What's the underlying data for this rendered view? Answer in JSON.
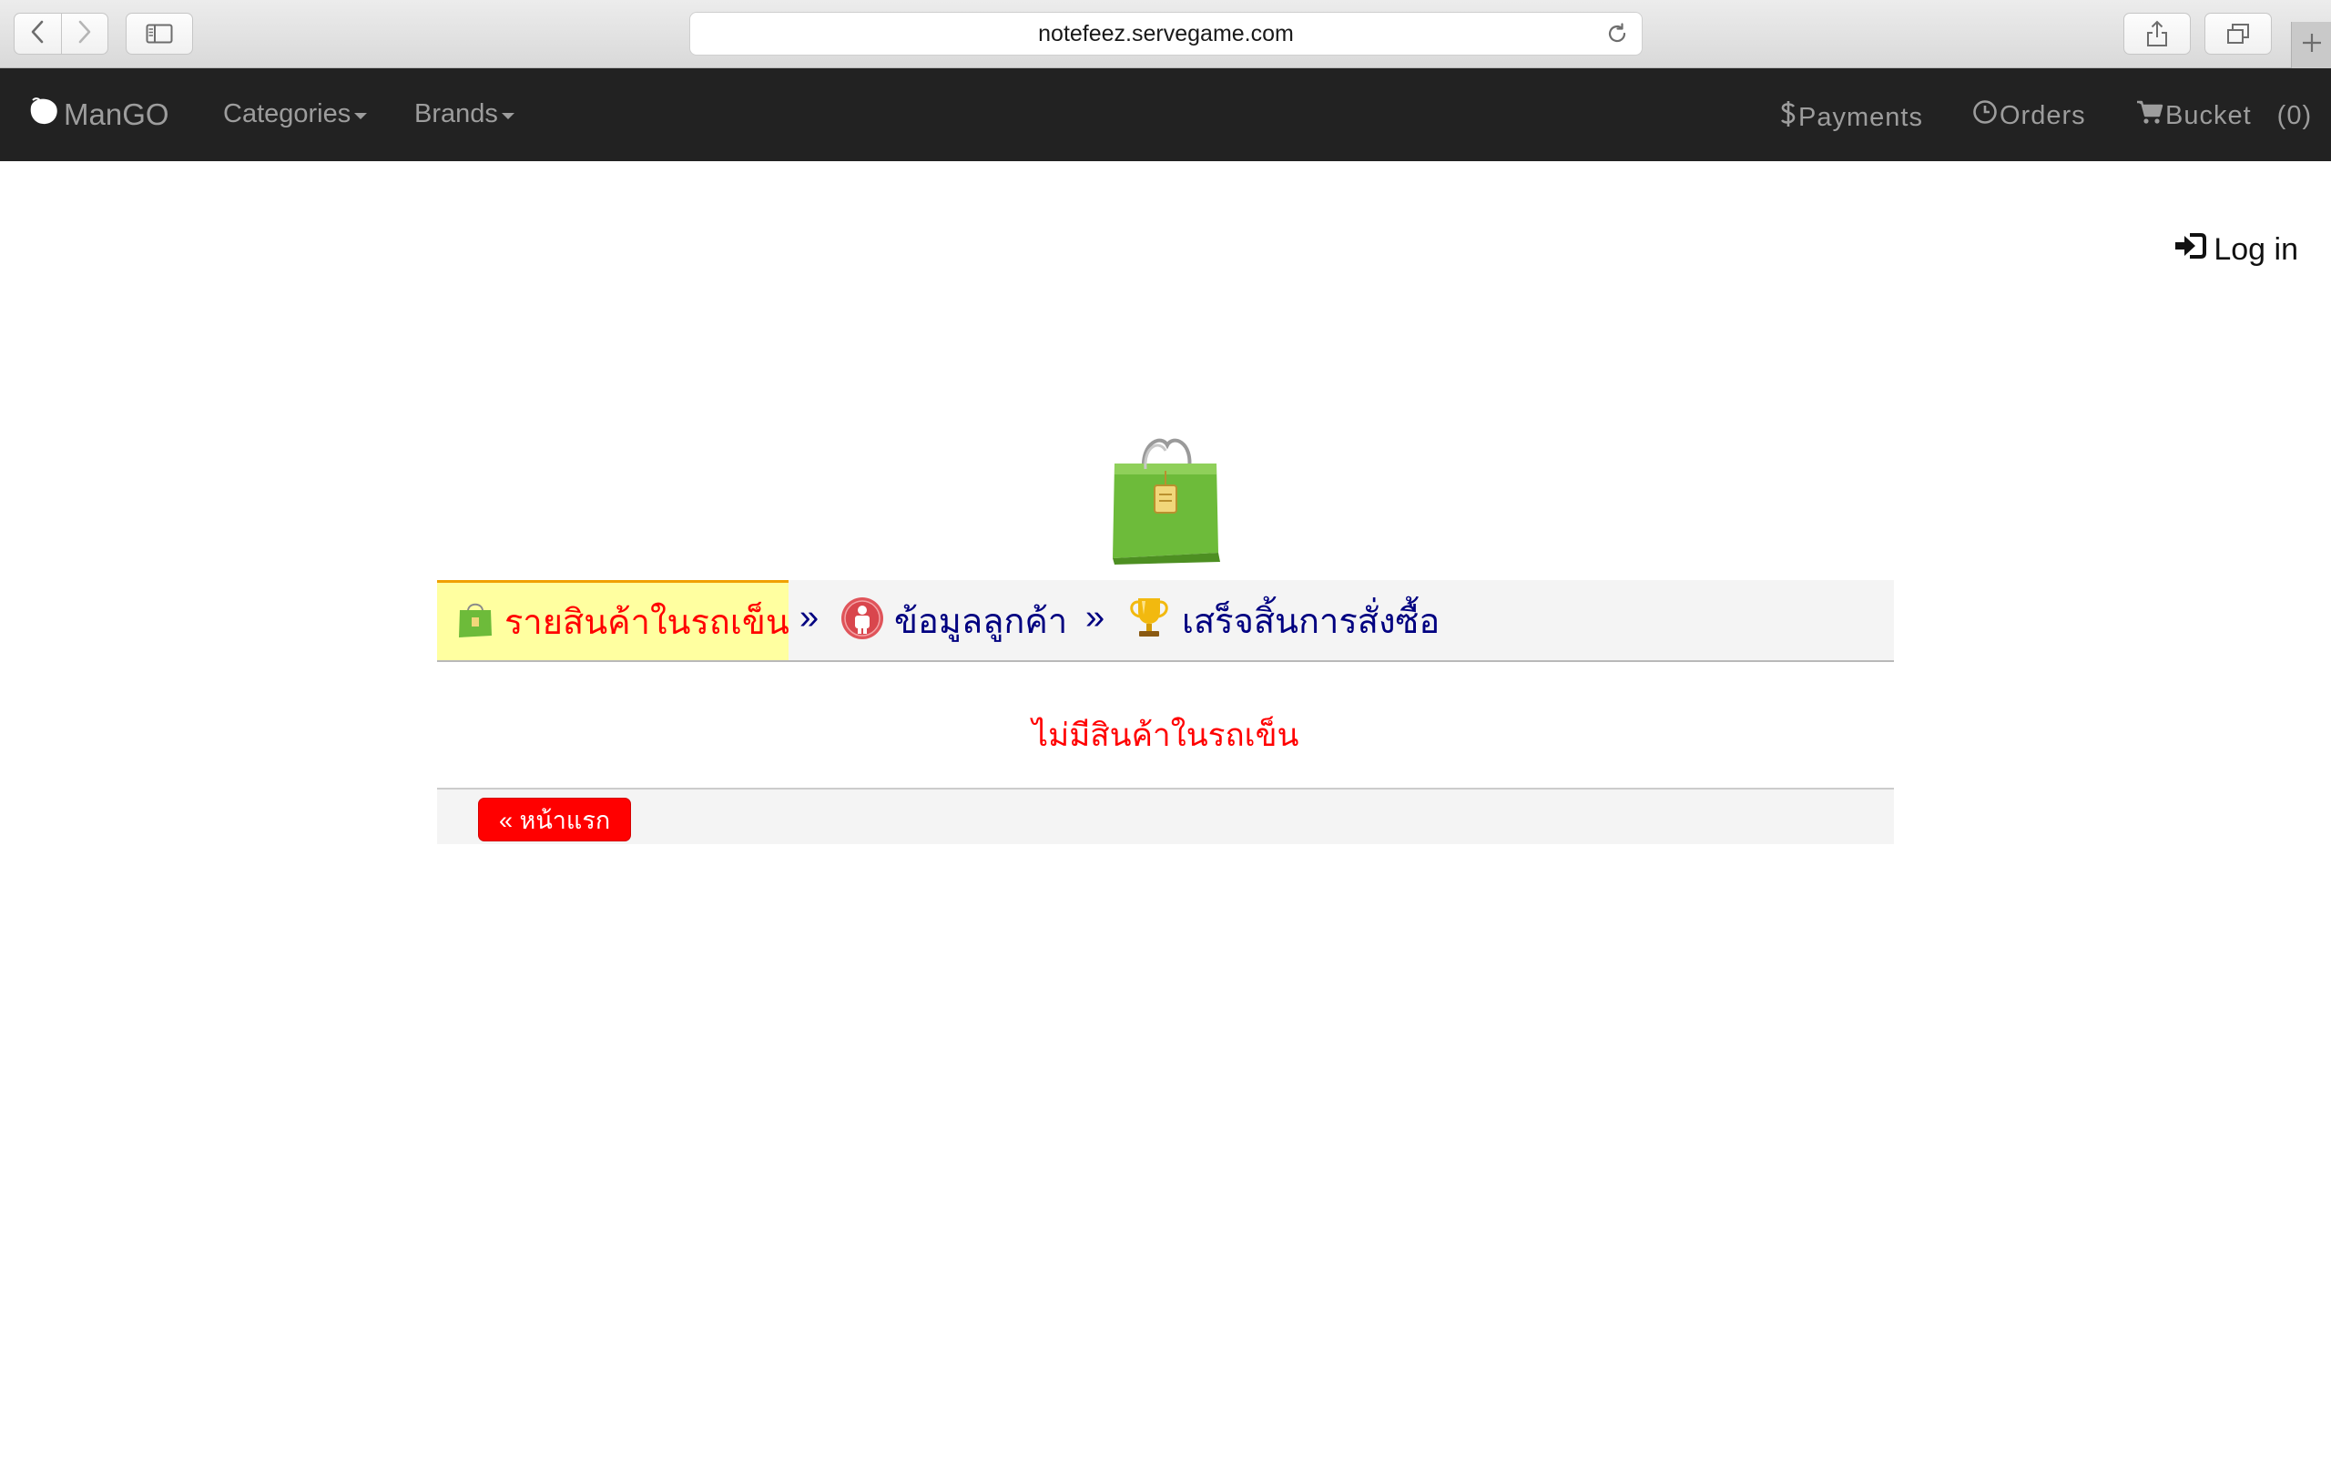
{
  "browser": {
    "url": "notefeez.servegame.com",
    "icons": [
      "back-arrow-icon",
      "forward-arrow-icon",
      "sidebar-icon",
      "reload-icon",
      "share-icon",
      "tabs-icon",
      "plus-icon"
    ]
  },
  "navbar": {
    "brand": "ManGO",
    "brand_icon": "mango-icon",
    "menus": [
      {
        "label": "Categories"
      },
      {
        "label": "Brands"
      }
    ],
    "right": {
      "payments": {
        "label": "Payments",
        "icon": "dollar-icon"
      },
      "orders": {
        "label": "Orders",
        "icon": "clock-icon"
      },
      "bucket": {
        "label": "Bucket",
        "icon": "cart-icon",
        "count": "(0)"
      }
    },
    "colors": {
      "background": "#222222",
      "text": "#9d9d9d"
    }
  },
  "login": {
    "label": "Log in",
    "icon": "log-in-icon"
  },
  "steps": {
    "items": [
      {
        "label": "รายสินค้าในรถเข็น",
        "icon": "shopping-bag-icon",
        "active": true
      },
      {
        "label": "ข้อมูลลูกค้า",
        "icon": "customer-icon",
        "active": false
      },
      {
        "label": "เสร็จสิ้นการสั่งซื้อ",
        "icon": "trophy-icon",
        "active": false
      }
    ],
    "separator": "»",
    "colors": {
      "active_bg": "#ffffa0",
      "active_text": "#ff0000",
      "text": "#000080"
    }
  },
  "cart": {
    "empty_message": "ไม่มีสินค้าในรถเข็น",
    "home_button": "« หน้าแรก",
    "colors": {
      "message": "#ff0000",
      "button": "#ff0000"
    }
  }
}
